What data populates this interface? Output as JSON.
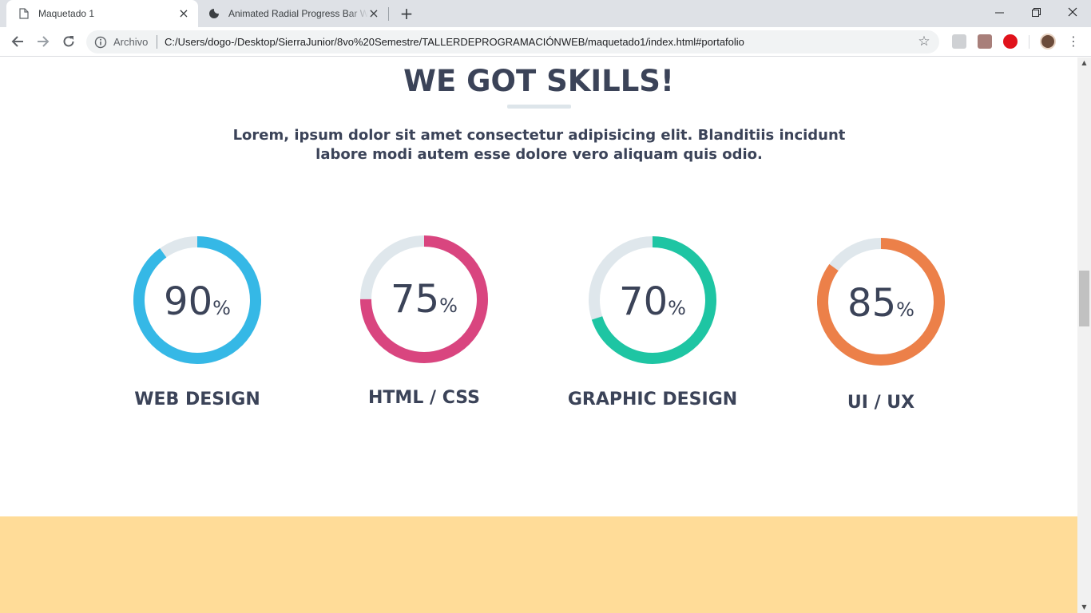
{
  "browser": {
    "tabs": [
      {
        "title": "Maquetado 1",
        "icon": "page-icon",
        "active": true
      },
      {
        "title": "Animated Radial Progress Bar W",
        "icon": "codepen-icon",
        "active": false
      }
    ],
    "address": {
      "scheme_label": "Archivo",
      "url": "C:/Users/dogo-/Desktop/SierraJunior/8vo%20Semestre/TALLERDEPROGRAMACIÓNWEB/maquetado1/index.html#portafolio"
    }
  },
  "page": {
    "title": "WE GOT SKILLS!",
    "description": "Lorem, ipsum dolor sit amet consectetur adipisicing elit. Blanditiis incidunt labore modi autem esse dolore vero aliquam quis odio.",
    "skills": [
      {
        "value": "90",
        "unit": "%",
        "percent": 90,
        "label": "WEB DESIGN",
        "color": "#35b8e6"
      },
      {
        "value": "75",
        "unit": "%",
        "percent": 75,
        "label": "HTML / CSS",
        "color": "#d9457f"
      },
      {
        "value": "70",
        "unit": "%",
        "percent": 70,
        "label": "GRAPHIC DESIGN",
        "color": "#1ec5a3"
      },
      {
        "value": "85",
        "unit": "%",
        "percent": 85,
        "label": "UI / UX",
        "color": "#ec8049"
      }
    ],
    "track_color": "#dfe7ec",
    "footer_color": "#ffdc98"
  }
}
